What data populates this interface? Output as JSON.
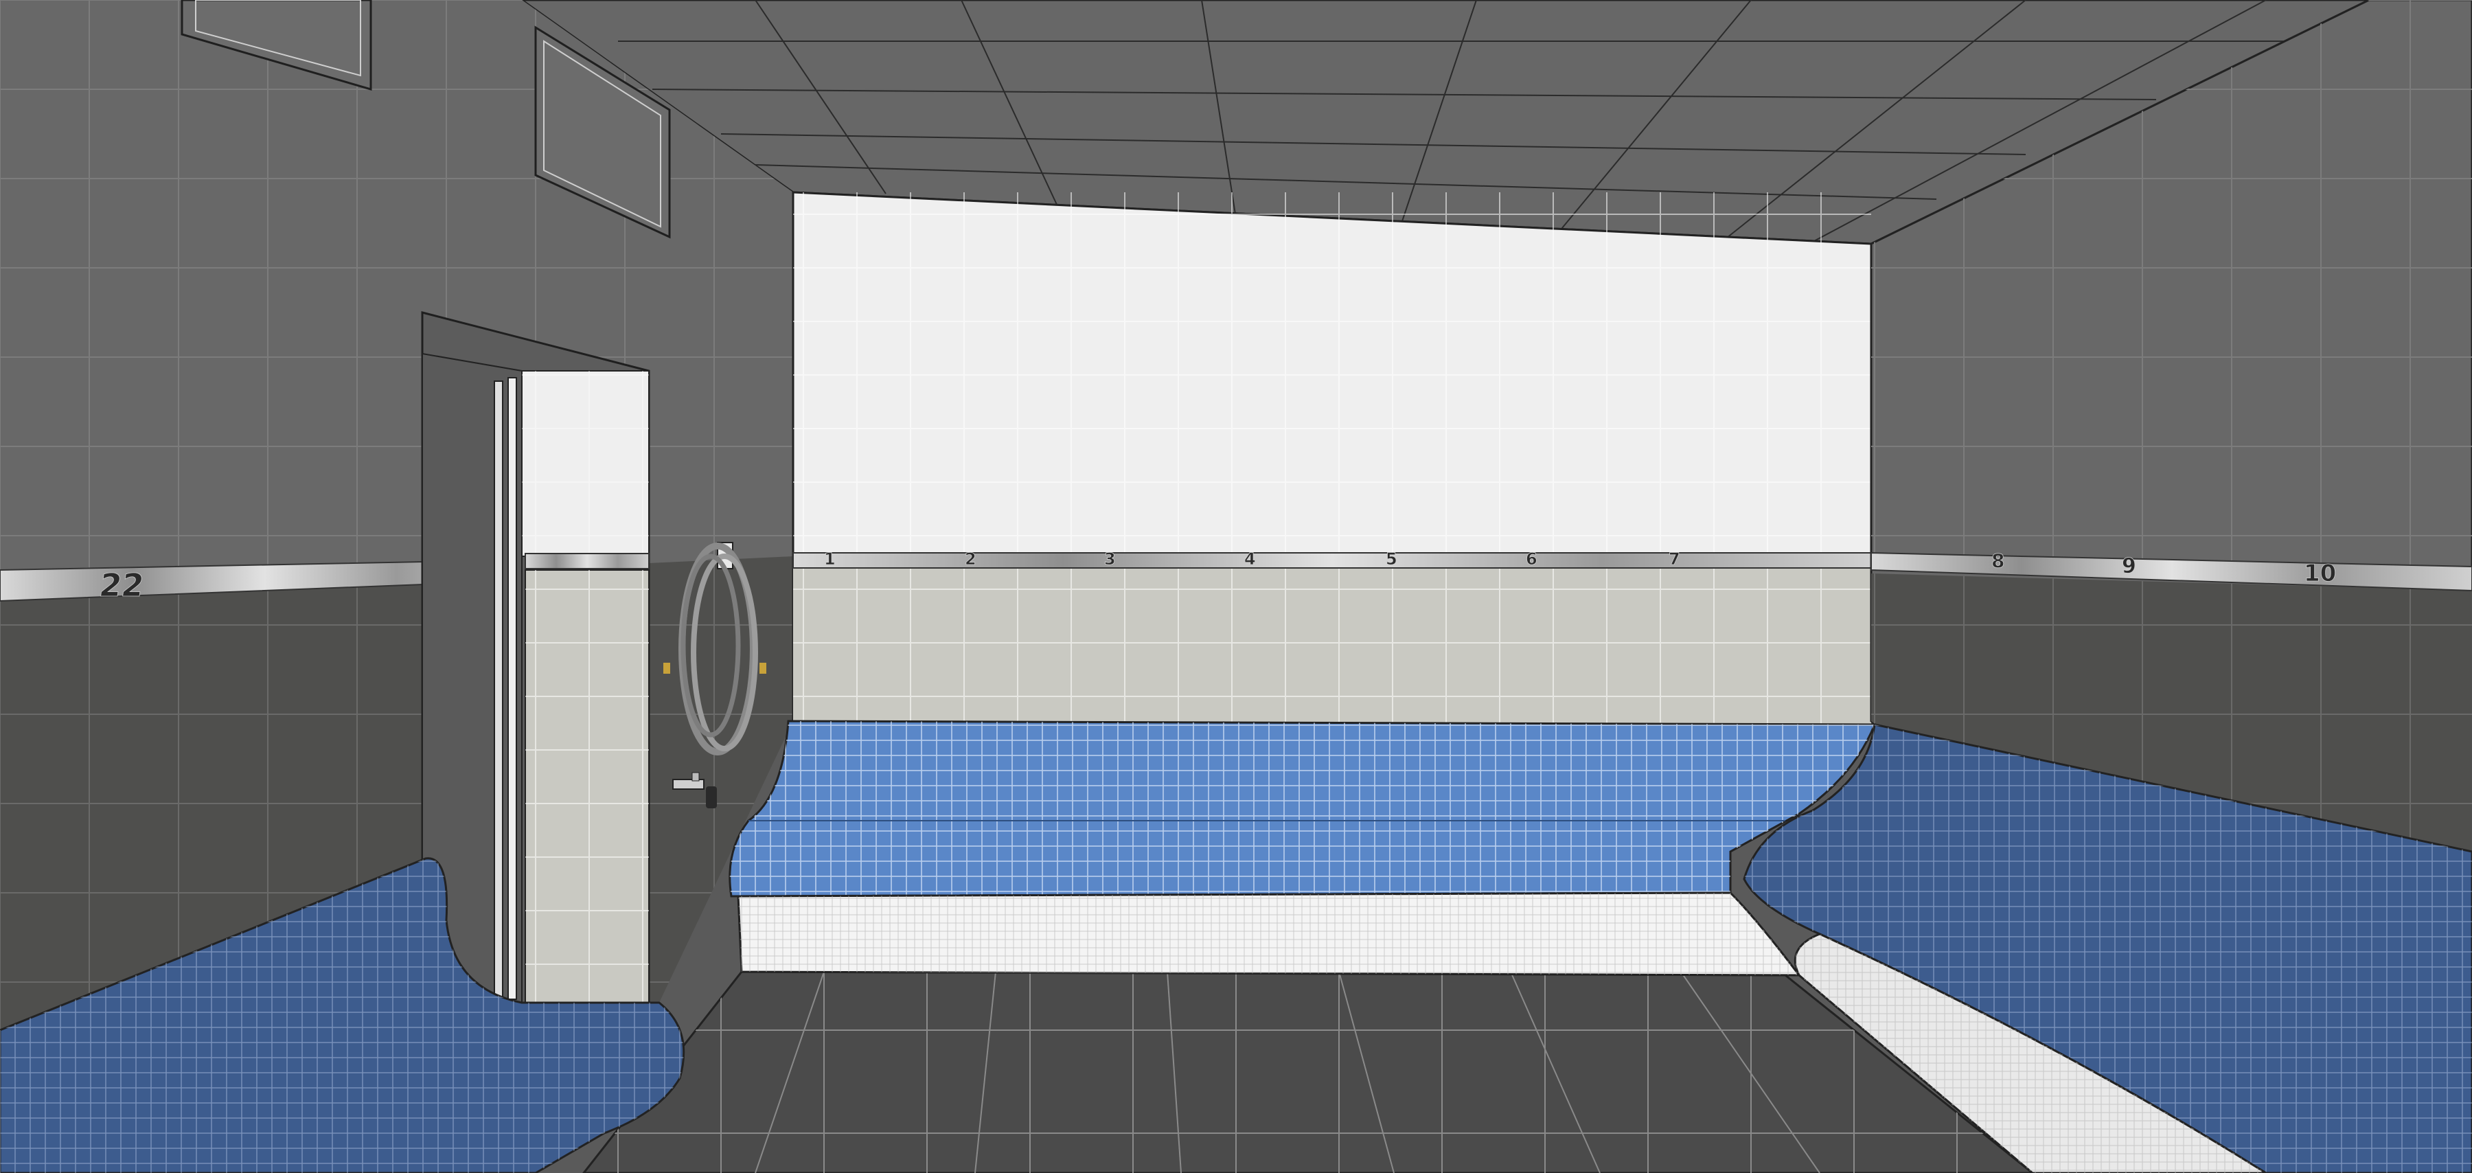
{
  "scene": {
    "colors": {
      "ceiling": "#666666",
      "wall_upper": "#6a6a6a",
      "wall_lower": "#4f4f4d",
      "back_wall_upper": "#efefef",
      "back_wall_lower": "#c9c9c2",
      "floor": "#4b4b4b",
      "bench_blue": "#5a87c8",
      "bench_dark_blue": "#354f7a",
      "bench_base": "#f4f4f4",
      "trim_steel": "#b8b8b8",
      "grout": "#ffffff"
    },
    "icons": {
      "hose": "coiled-hose-icon",
      "faucet": "wall-faucet-icon"
    }
  },
  "seat_numbers": [
    "22",
    "1",
    "2",
    "3",
    "4",
    "5",
    "6",
    "7",
    "8",
    "9",
    "10"
  ]
}
